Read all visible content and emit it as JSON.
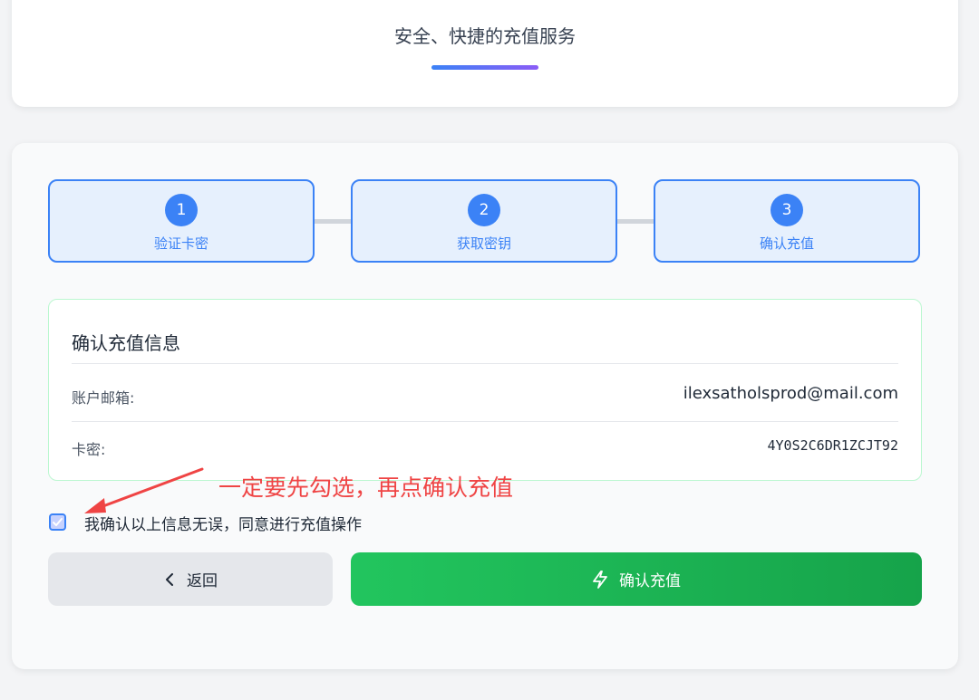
{
  "header": {
    "subtitle": "安全、快捷的充值服务"
  },
  "steps": [
    {
      "number": "1",
      "label": "验证卡密"
    },
    {
      "number": "2",
      "label": "获取密钥"
    },
    {
      "number": "3",
      "label": "确认充值"
    }
  ],
  "confirm_info": {
    "title": "确认充值信息",
    "rows": [
      {
        "label": "账户邮箱:",
        "value": "ilexsatholsprod@mail.com"
      },
      {
        "label": "卡密:",
        "value": "4Y0S2C6DR1ZCJT92"
      }
    ]
  },
  "annotation": {
    "text": "一定要先勾选，再点确认充值",
    "color": "#ef4444"
  },
  "agreement": {
    "checked": true,
    "label": "我确认以上信息无误，同意进行充值操作"
  },
  "buttons": {
    "back_label": "返回",
    "back_icon": "chevron-left-icon",
    "confirm_label": "确认充值",
    "confirm_icon": "lightning-icon"
  },
  "colors": {
    "accent": "#3b82f6",
    "success": "#22c55e",
    "annotation": "#ef4444"
  }
}
